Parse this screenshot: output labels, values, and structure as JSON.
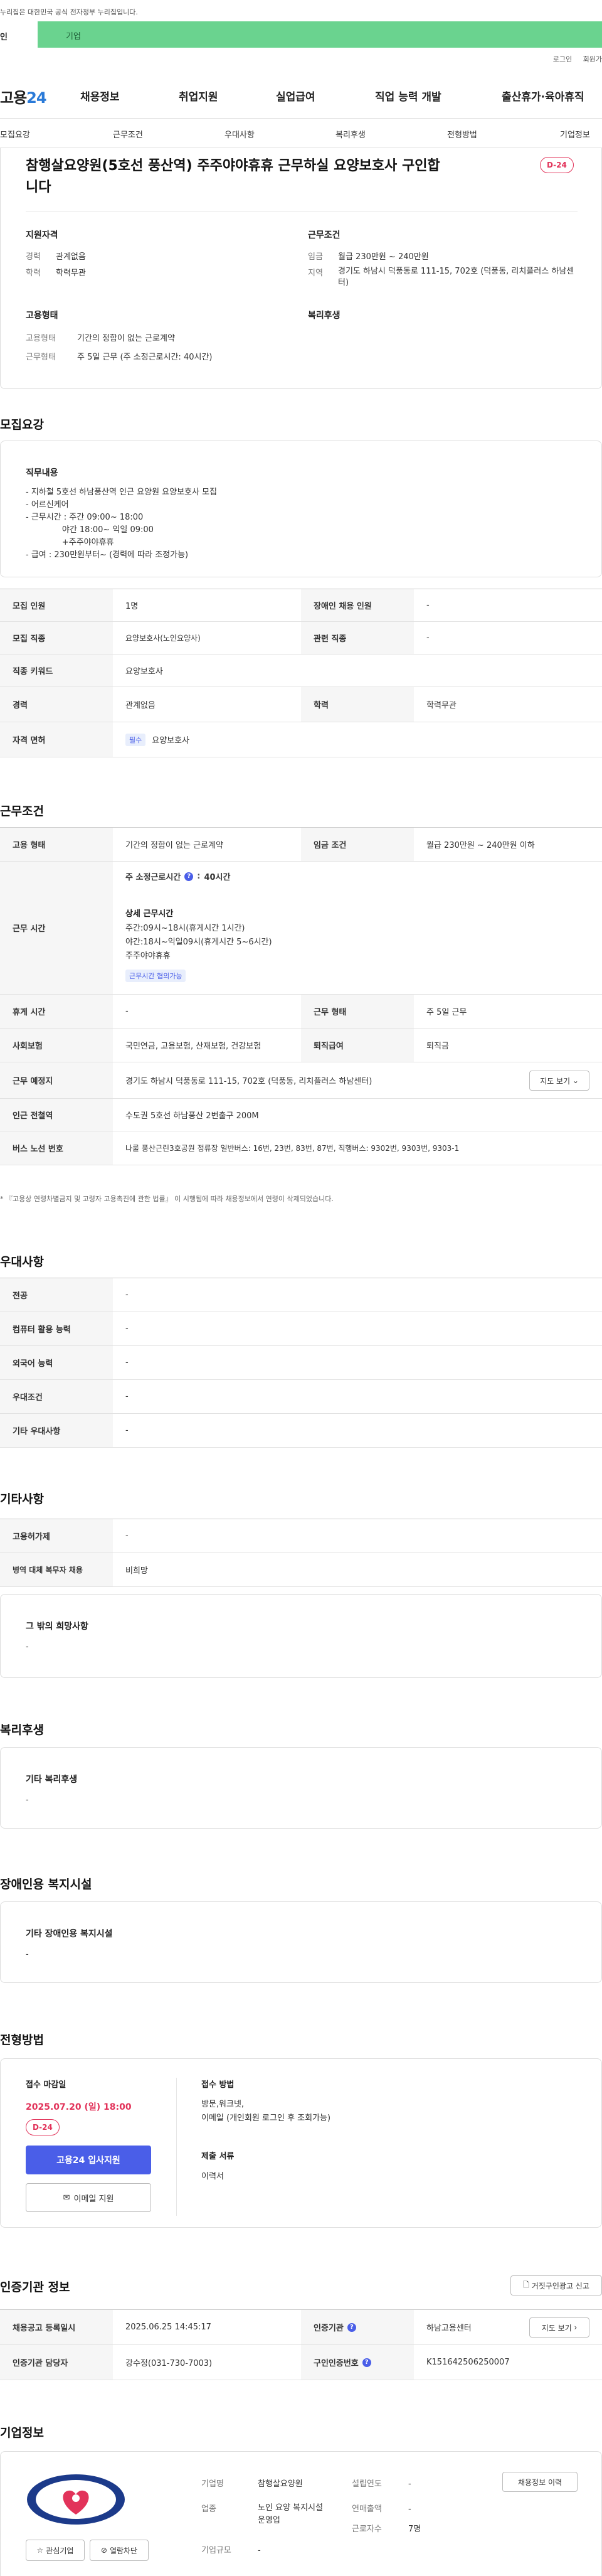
{
  "gov_notice": "누리집은 대한민국 공식 전자정부 누리집입니다.",
  "top_tabs": [
    "인",
    "기업"
  ],
  "util": [
    "로그인",
    "회원가"
  ],
  "logo": {
    "text": "고용",
    "accent": "24"
  },
  "gnb": [
    "채용정보",
    "취업지원",
    "실업급여",
    "직업 능력 개발",
    "출산휴가·육아휴직"
  ],
  "subnav": [
    "모집요강",
    "근무조건",
    "우대사항",
    "복리후생",
    "전형방법",
    "기업정보"
  ],
  "job": {
    "title": "참행살요양원(5호선 풍산역) 주주야야휴휴 근무하실 요양보호사 구인합니다",
    "dday": "D-24",
    "qual_h": "지원자격",
    "career_k": "경력",
    "career_v": "관계없음",
    "edu_k": "학력",
    "edu_v": "학력무관",
    "cond_h": "근무조건",
    "wage_k": "임금",
    "wage_v": "월급 230만원 ~ 240만원",
    "region_k": "지역",
    "region_v": "경기도 하남시 덕풍동로 111-15, 702호 (덕풍동, 리치플러스 하남센터)",
    "emp_h": "고용형태",
    "type_k": "고용형태",
    "type_v": "기간의 정함이 없는 근로계약",
    "form_k": "근무형태",
    "form_v": "주 5일 근무 (주 소정근로시간: 40시간)",
    "welfare_h": "복리후생"
  },
  "recruit": {
    "title": "모집요강",
    "duty_h": "직무내용",
    "duty_text": "- 지하철 5호선 하남풍산역 인근 요양원 요양보호사 모집\n- 어르신케어\n- 근무시간 : 주간 09:00~ 18:00\n              야간 18:00~ 익일 09:00\n              +주주야야휴휴\n- 급여 : 230만원부터~ (경력에 따라 조정가능)",
    "rows": [
      {
        "k1": "모집 인원",
        "v1": "1명",
        "k2": "장애인 채용 인원",
        "v2": "-"
      },
      {
        "k1": "모집 직종",
        "v1": "요양보호사(노인요양사)",
        "k2": "관련 직종",
        "v2": "-"
      },
      {
        "k1": "직종 키워드",
        "v1": "요양보호사"
      },
      {
        "k1": "경력",
        "v1": "관계없음",
        "k2": "학력",
        "v2": "학력무관"
      },
      {
        "k1": "자격 면허",
        "badge": "필수",
        "v1": "요양보호사"
      }
    ]
  },
  "work": {
    "title": "근무조건",
    "type_k": "고용 형태",
    "type_v": "기간의 정함이 없는 근로계약",
    "wage_k": "임금 조건",
    "wage_v": "월급 230만원 ~ 240만원 이하",
    "time_k": "근무 시간",
    "weekly": "주 소정근로시간",
    "weekly_v": "40시간",
    "detail_h": "상세 근무시간",
    "detail_text": "주간:09시~18시(휴게시간 1시간)\n야간:18시~익일09시(휴게시간 5~6시간)\n주주야야휴휴",
    "flex_badge": "근무시간 협의가능",
    "rest_k": "휴게 시간",
    "rest_v": "-",
    "form_k": "근무 형태",
    "form_v": "주 5일 근무",
    "ins_k": "사회보험",
    "ins_v": "국민연금, 고용보험, 산재보험, 건강보험",
    "retire_k": "퇴직급여",
    "retire_v": "퇴직금",
    "addr_k": "근무 예정지",
    "addr_v": "경기도 하남시 덕풍동로 111-15, 702호 (덕풍동, 리치플러스 하남센터)",
    "map_btn": "지도 보기",
    "subway_k": "인근 전철역",
    "subway_v": "수도권 5호선 하남풍산 2번출구 200M",
    "bus_k": "버스 노선 번호",
    "bus_v": "나룰 풍산근린3호공원 정류장 일반버스: 16번, 23번, 83번, 87번, 직행버스: 9302번, 9303번, 9303-1",
    "note": "* 『고용상 연령차별금지 및 고령자 고용촉진에 관한 법률』 이 시행됨에 따라 채용정보에서 연령이 삭제되었습니다."
  },
  "pref": {
    "title": "우대사항",
    "rows": [
      {
        "k": "전공",
        "v": "-"
      },
      {
        "k": "컴퓨터 활용 능력",
        "v": "-"
      },
      {
        "k": "외국어 능력",
        "v": "-"
      },
      {
        "k": "우대조건",
        "v": "-"
      },
      {
        "k": "기타 우대사항",
        "v": "-"
      }
    ]
  },
  "etc": {
    "title": "기타사항",
    "rows": [
      {
        "k": "고용허가제",
        "v": "-"
      },
      {
        "k": "병역 대체 복무자 채용",
        "v": "비희망"
      }
    ],
    "other_h": "그 밖의 희망사항",
    "other_v": "-"
  },
  "welfare": {
    "title": "복리후생",
    "h": "기타 복리후생",
    "v": "-"
  },
  "disabled": {
    "title": "장애인용 복지시설",
    "h": "기타 장애인용 복지시설",
    "v": "-"
  },
  "process": {
    "title": "전형방법",
    "deadline_h": "접수 마감일",
    "deadline_v": "2025.07.20 (일) 18:00",
    "dday": "D-24",
    "apply_btn": "고용24 입사지원",
    "email_btn": "이메일 지원",
    "method_h": "접수 방법",
    "method_v": "방문,워크넷,\n이메일 (개인회원 로그인 후 조회가능)",
    "docs_h": "제출 서류",
    "docs_v": "이력서"
  },
  "agency": {
    "title": "인증기관 정보",
    "report_btn": "거짓구인광고 신고",
    "reg_k": "채용공고 등록일시",
    "reg_v": "2025.06.25 14:45:17",
    "org_k": "인증기관",
    "org_v": "하남고용센터",
    "map_btn": "지도 보기",
    "staff_k": "인증기관 담당자",
    "staff_v": "강수정(031-730-7003)",
    "no_k": "구인인증번호",
    "no_v": "K151642506250007"
  },
  "company": {
    "title": "기업정보",
    "fav_btn": "관심기업",
    "block_btn": "열람차단",
    "list_btn": "채용정보 이력",
    "name_k": "기업명",
    "name_v": "참행살요양원",
    "founded_k": "설립연도",
    "founded_v": "-",
    "biz_k": "업종",
    "biz_v": "노인 요양 복지시설 운영업",
    "sales_k": "연매출액",
    "sales_v": "-",
    "emp_k": "근로자수",
    "emp_v": "7명",
    "size_k": "기업규모",
    "size_v": "-"
  },
  "colors": {
    "accent": "#4a5ee8",
    "danger": "#e2335a",
    "toptab": "#6ad38f"
  }
}
